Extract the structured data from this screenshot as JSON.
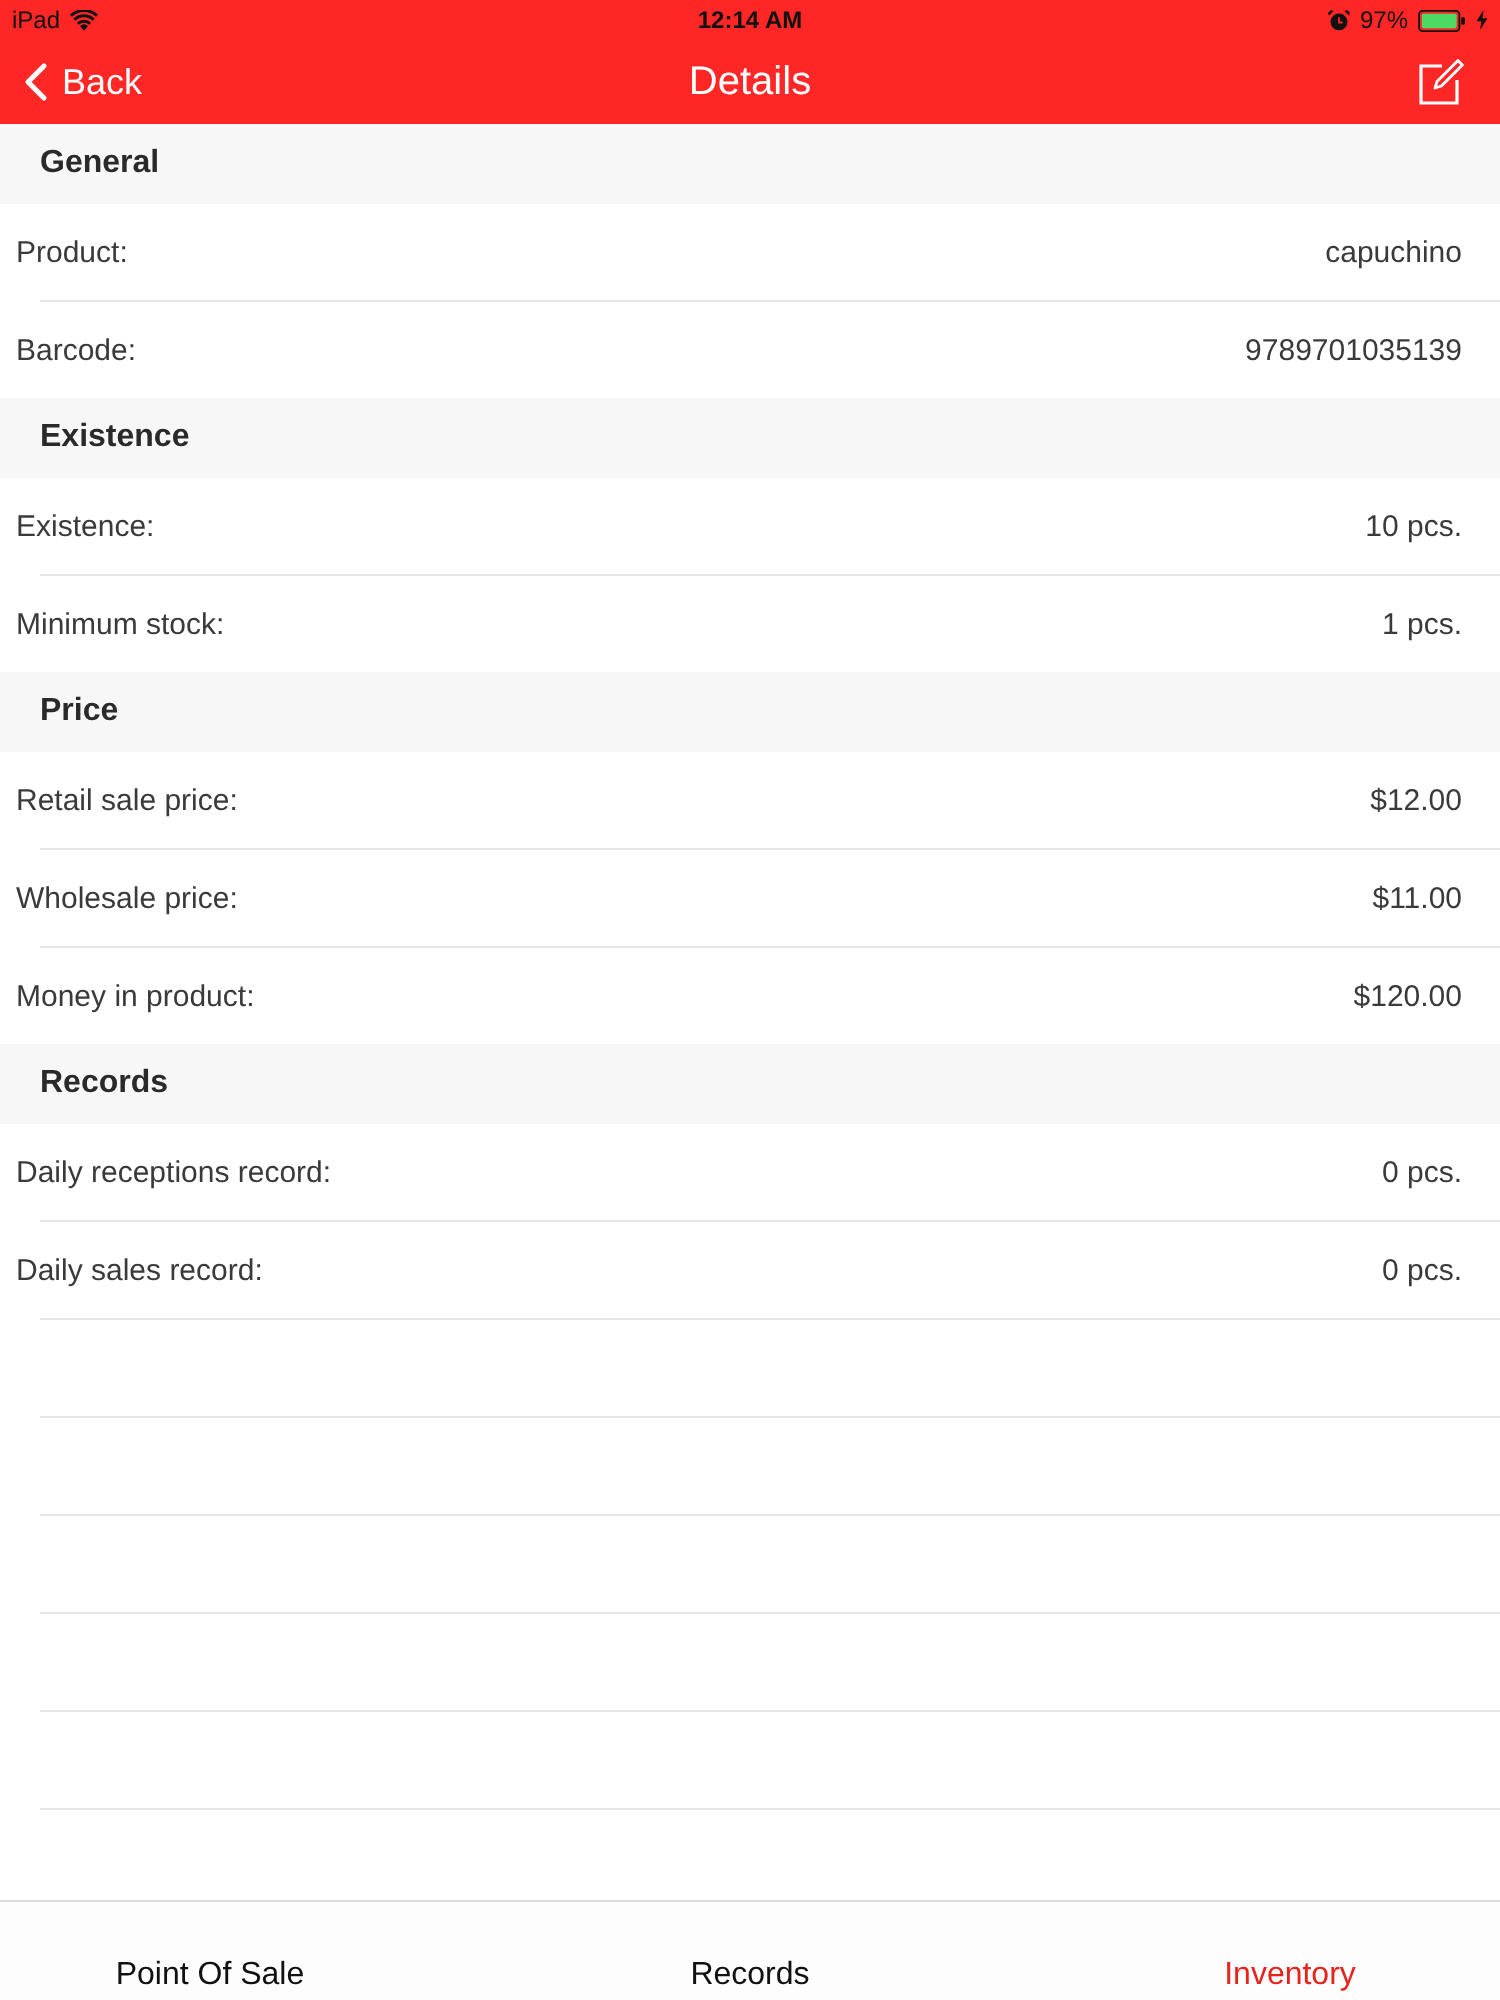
{
  "status_bar": {
    "device": "iPad",
    "time": "12:14 AM",
    "battery": "97%"
  },
  "nav_bar": {
    "back_label": "Back",
    "title": "Details"
  },
  "sections": [
    {
      "title": "General",
      "rows": [
        {
          "label": "Product:",
          "value": "capuchino"
        },
        {
          "label": "Barcode:",
          "value": "9789701035139"
        }
      ]
    },
    {
      "title": "Existence",
      "rows": [
        {
          "label": "Existence:",
          "value": "10 pcs."
        },
        {
          "label": "Minimum stock:",
          "value": "1 pcs."
        }
      ]
    },
    {
      "title": "Price",
      "rows": [
        {
          "label": "Retail sale price:",
          "value": "$12.00"
        },
        {
          "label": "Wholesale price:",
          "value": "$11.00"
        },
        {
          "label": "Money in product:",
          "value": "$120.00"
        }
      ]
    },
    {
      "title": "Records",
      "rows": [
        {
          "label": "Daily receptions record:",
          "value": "0 pcs."
        },
        {
          "label": "Daily sales record:",
          "value": "0 pcs."
        }
      ]
    }
  ],
  "tab_bar": [
    {
      "label": "Point Of Sale",
      "selected": false
    },
    {
      "label": "Records",
      "selected": false
    },
    {
      "label": "Inventory",
      "selected": true
    }
  ]
}
